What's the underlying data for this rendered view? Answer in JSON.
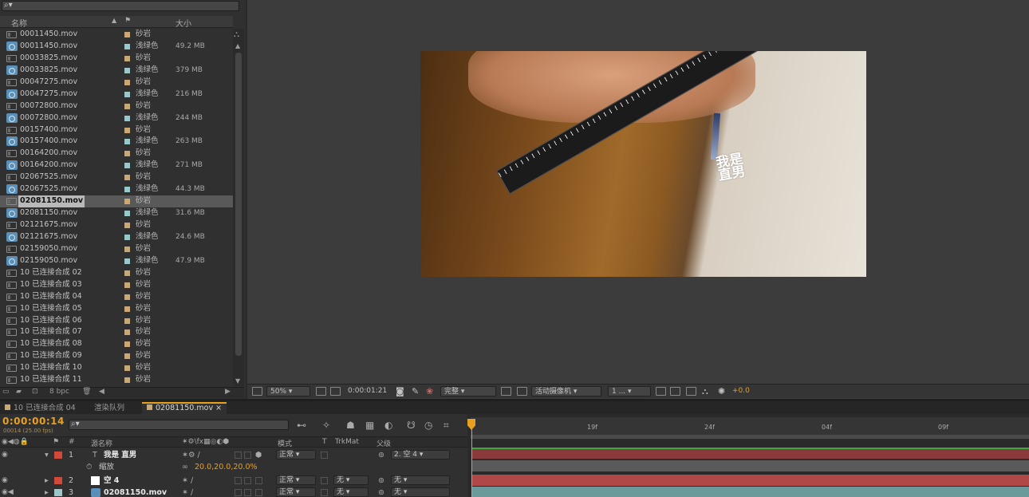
{
  "project": {
    "search_icon": "⌕▾",
    "columns": {
      "name": "名称",
      "label_icon": "tag-icon",
      "size": "大小"
    },
    "items": [
      {
        "name": "00011450.mov",
        "type": "comp",
        "label": "砂岩",
        "color": "#c8a878",
        "size": ""
      },
      {
        "name": "00011450.mov",
        "type": "footage",
        "label": "浅绿色",
        "color": "#9ac8c8",
        "size": "49.2 MB"
      },
      {
        "name": "00033825.mov",
        "type": "comp",
        "label": "砂岩",
        "color": "#c8a878",
        "size": ""
      },
      {
        "name": "00033825.mov",
        "type": "footage",
        "label": "浅绿色",
        "color": "#9ac8c8",
        "size": "379 MB"
      },
      {
        "name": "00047275.mov",
        "type": "comp",
        "label": "砂岩",
        "color": "#c8a878",
        "size": ""
      },
      {
        "name": "00047275.mov",
        "type": "footage",
        "label": "浅绿色",
        "color": "#9ac8c8",
        "size": "216 MB"
      },
      {
        "name": "00072800.mov",
        "type": "comp",
        "label": "砂岩",
        "color": "#c8a878",
        "size": ""
      },
      {
        "name": "00072800.mov",
        "type": "footage",
        "label": "浅绿色",
        "color": "#9ac8c8",
        "size": "244 MB"
      },
      {
        "name": "00157400.mov",
        "type": "comp",
        "label": "砂岩",
        "color": "#c8a878",
        "size": ""
      },
      {
        "name": "00157400.mov",
        "type": "footage",
        "label": "浅绿色",
        "color": "#9ac8c8",
        "size": "263 MB"
      },
      {
        "name": "00164200.mov",
        "type": "comp",
        "label": "砂岩",
        "color": "#c8a878",
        "size": ""
      },
      {
        "name": "00164200.mov",
        "type": "footage",
        "label": "浅绿色",
        "color": "#9ac8c8",
        "size": "271 MB"
      },
      {
        "name": "02067525.mov",
        "type": "comp",
        "label": "砂岩",
        "color": "#c8a878",
        "size": ""
      },
      {
        "name": "02067525.mov",
        "type": "footage",
        "label": "浅绿色",
        "color": "#9ac8c8",
        "size": "44.3 MB"
      },
      {
        "name": "02081150.mov",
        "type": "comp",
        "label": "砂岩",
        "color": "#c8a878",
        "size": "",
        "selected": true
      },
      {
        "name": "02081150.mov",
        "type": "footage",
        "label": "浅绿色",
        "color": "#9ac8c8",
        "size": "31.6 MB"
      },
      {
        "name": "02121675.mov",
        "type": "comp",
        "label": "砂岩",
        "color": "#c8a878",
        "size": ""
      },
      {
        "name": "02121675.mov",
        "type": "footage",
        "label": "浅绿色",
        "color": "#9ac8c8",
        "size": "24.6 MB"
      },
      {
        "name": "02159050.mov",
        "type": "comp",
        "label": "砂岩",
        "color": "#c8a878",
        "size": ""
      },
      {
        "name": "02159050.mov",
        "type": "footage",
        "label": "浅绿色",
        "color": "#9ac8c8",
        "size": "47.9 MB"
      },
      {
        "name": "10 已连接合成 02",
        "type": "comp",
        "label": "砂岩",
        "color": "#c8a878",
        "size": ""
      },
      {
        "name": "10 已连接合成 03",
        "type": "comp",
        "label": "砂岩",
        "color": "#c8a878",
        "size": ""
      },
      {
        "name": "10 已连接合成 04",
        "type": "comp",
        "label": "砂岩",
        "color": "#c8a878",
        "size": ""
      },
      {
        "name": "10 已连接合成 05",
        "type": "comp",
        "label": "砂岩",
        "color": "#c8a878",
        "size": ""
      },
      {
        "name": "10 已连接合成 06",
        "type": "comp",
        "label": "砂岩",
        "color": "#c8a878",
        "size": ""
      },
      {
        "name": "10 已连接合成 07",
        "type": "comp",
        "label": "砂岩",
        "color": "#c8a878",
        "size": ""
      },
      {
        "name": "10 已连接合成 08",
        "type": "comp",
        "label": "砂岩",
        "color": "#c8a878",
        "size": ""
      },
      {
        "name": "10 已连接合成 09",
        "type": "comp",
        "label": "砂岩",
        "color": "#c8a878",
        "size": ""
      },
      {
        "name": "10 已连接合成 10",
        "type": "comp",
        "label": "砂岩",
        "color": "#c8a878",
        "size": ""
      },
      {
        "name": "10 已连接合成 11",
        "type": "comp",
        "label": "砂岩",
        "color": "#c8a878",
        "size": ""
      }
    ],
    "bpc": "8 bpc"
  },
  "viewer": {
    "overlay_line1": "我是",
    "overlay_line2": "直男",
    "zoom": "50%",
    "timecode": "0:00:01:21",
    "resolution": "完整",
    "camera": "活动摄像机",
    "views": "1 ...",
    "exposure": "+0.0"
  },
  "timeline": {
    "tabs": [
      "10 已连接合成 04",
      "渲染队列",
      "02081150.mov"
    ],
    "current_time": "0:00:00:14",
    "frame_info": "00014 (25.00 fps)",
    "columns": {
      "source_name": "源名称",
      "mode": "模式",
      "t": "T",
      "trkmat": "TrkMat",
      "parent": "父级"
    },
    "ruler_ticks": [
      "19f",
      "24f",
      "04f",
      "09f"
    ],
    "layers": [
      {
        "num": "1",
        "name": "我是 直男",
        "mode": "正常",
        "trkmat": "",
        "parent": "2. 空 4",
        "color": "#d04a3a"
      },
      {
        "num": "",
        "name": "缩放",
        "scale": "20.0,20.0,20.0%"
      },
      {
        "num": "2",
        "name": "空 4",
        "mode": "正常",
        "trkmat": "无",
        "parent": "无",
        "color": "#d04a3a"
      },
      {
        "num": "3",
        "name": "02081150.mov",
        "mode": "正常",
        "trkmat": "无",
        "parent": "无",
        "color": "#9ac8c8"
      }
    ]
  },
  "colors": {
    "accent": "#e8a020",
    "layer_red": "#b84a4a",
    "layer_teal": "#6a9a9a"
  }
}
